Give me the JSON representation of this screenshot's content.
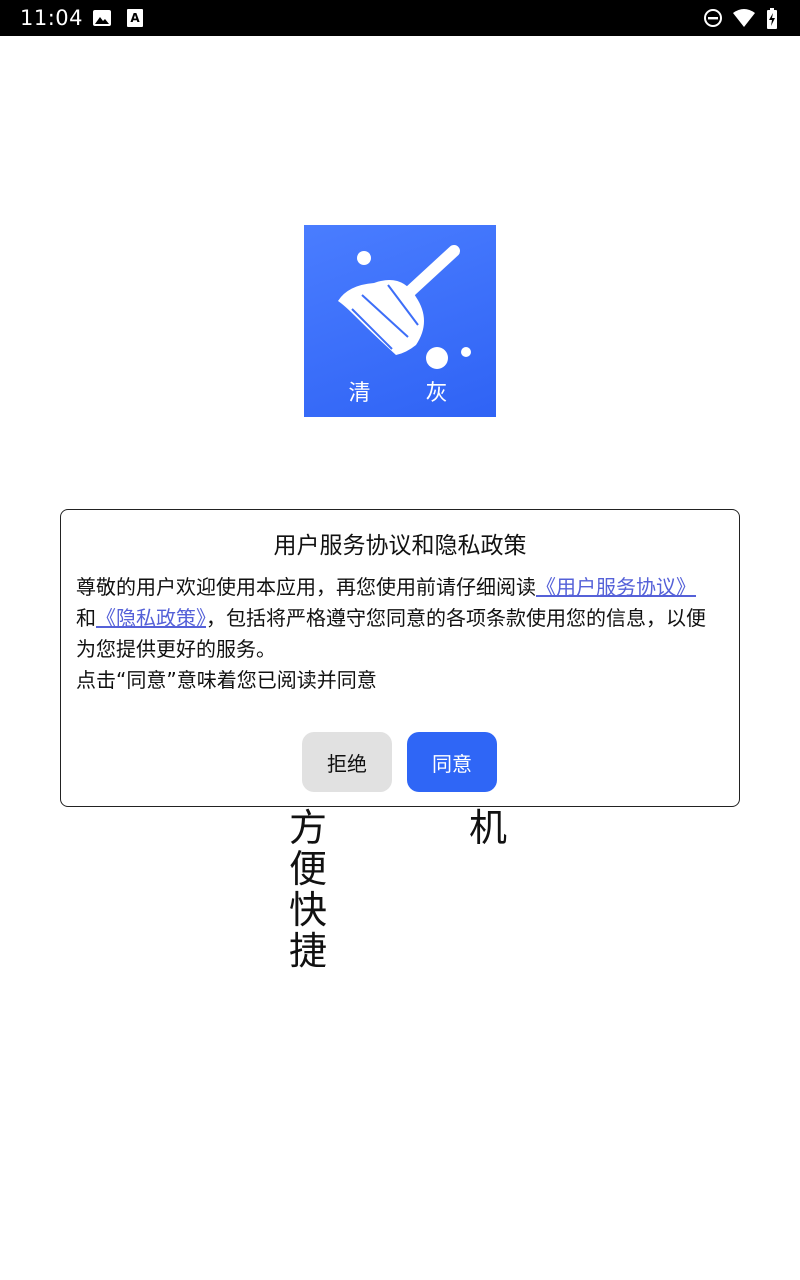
{
  "status_bar": {
    "time": "11:04",
    "left_icons": [
      "image-icon",
      "text-a-icon"
    ],
    "right_icons": [
      "do-not-disturb-icon",
      "wifi-icon",
      "battery-icon"
    ]
  },
  "app": {
    "logo_text": "清 灰",
    "brand_color": "#2f66f6"
  },
  "dialog": {
    "title": "用户服务协议和隐私政策",
    "body_intro": " 尊敬的用户欢迎使用本应用，再您使用前请仔细阅读",
    "link_terms": "《用户服务协议》",
    "and": "和",
    "link_privacy": "《隐私政策》",
    "body_rest": "，包括将严格遵守您同意的各项条款使用您的信息，以便为您提供更好的服务。",
    "body_line2": "点击“同意”意味着您已阅读并同意",
    "reject_label": "拒绝",
    "agree_label": "同意"
  },
  "background_text": {
    "left_column": "方便快捷",
    "right_column": "机"
  }
}
